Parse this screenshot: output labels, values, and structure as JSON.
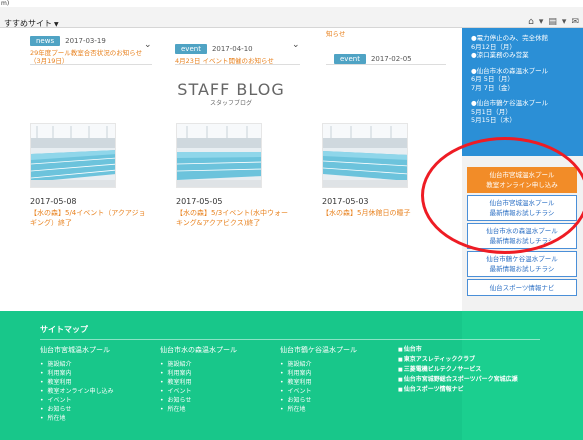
{
  "browser": {
    "top_tab": "m)",
    "favorites_label": "すすめサイト",
    "tools": [
      "home-icon",
      "chevron-down-icon",
      "feed-icon",
      "chevron-down-icon",
      "mail-icon"
    ]
  },
  "news": [
    {
      "badge": "news",
      "date": "2017-03-19",
      "title": "29年度プール教室合否状況のお知らせ（3月19日）"
    },
    {
      "badge": "event",
      "date": "2017-04-10",
      "title": "4月23日 イベント開催のお知らせ"
    },
    {
      "badge": "event",
      "date": "2017-02-05",
      "title": "知らせ"
    }
  ],
  "blog": {
    "title": "STAFF BLOG",
    "subtitle": "スタッフブログ",
    "posts": [
      {
        "date": "2017-05-08",
        "title": "【水の森】5/4イベント（アクアジョギング）終了"
      },
      {
        "date": "2017-05-05",
        "title": "【水の森】5/3イベント(水中ウォーキング&アクアビクス)終了"
      },
      {
        "date": "2017-05-03",
        "title": "【水の森】5月休館日の瞳子"
      }
    ]
  },
  "sidebar": {
    "notices": [
      "●電力停止のみ、完全休館",
      "6月12日（月）",
      "●涼口業務のみ営業",
      "●仙台市水の森温水プール",
      "6月 5日（月）",
      "7月 7日（金）",
      "●仙台市鶴ケ谷温水プール",
      "5月1日（月）",
      "5月15日（木）"
    ],
    "buttons": [
      {
        "line1": "仙台市宮城温水プール",
        "line2": "教室オンライン申し込み"
      },
      {
        "line1": "仙台市宮城温水プール",
        "line2": "最新情報お試しチラシ"
      },
      {
        "line1": "仙台市水の森温水プール",
        "line2": "最新情報お試しチラシ"
      },
      {
        "line1": "仙台市鶴ケ谷温水プール",
        "line2": "最新情報お試しチラシ"
      },
      {
        "line1": "仙台スポーツ情報ナビ",
        "line2": ""
      }
    ]
  },
  "footer": {
    "title": "サイトマップ",
    "columns": [
      {
        "heading": "仙台市宮城温水プール",
        "items": [
          "施設紹介",
          "利用案内",
          "教室利用",
          "教室オンライン申し込み",
          "イベント",
          "お知らせ",
          "所在地"
        ]
      },
      {
        "heading": "仙台市水の森温水プール",
        "items": [
          "施設紹介",
          "利用案内",
          "教室利用",
          "イベント",
          "お知らせ",
          "所在地"
        ]
      },
      {
        "heading": "仙台市鶴ケ谷温水プール",
        "items": [
          "施設紹介",
          "利用案内",
          "教室利用",
          "イベント",
          "お知らせ",
          "所在地"
        ]
      }
    ],
    "links": [
      "仙台市",
      "東京アスレティッククラブ",
      "三菱電機ビルテクノサービス",
      "仙台市宮城野総合スポーツパーク宮城広瀬",
      "仙台スポーツ情報ナビ"
    ]
  }
}
